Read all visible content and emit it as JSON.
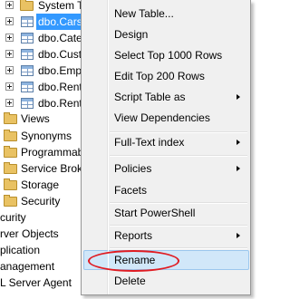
{
  "tree": {
    "rows": [
      {
        "label": "System Ta",
        "icon": "folder-icon"
      },
      {
        "label": "dbo.Cars",
        "icon": "table-icon",
        "selected": true
      },
      {
        "label": "dbo.Cate",
        "icon": "table-icon"
      },
      {
        "label": "dbo.Cust",
        "icon": "table-icon"
      },
      {
        "label": "dbo.Emp",
        "icon": "table-icon"
      },
      {
        "label": "dbo.Rent",
        "icon": "table-icon"
      },
      {
        "label": "dbo.Rent",
        "icon": "table-icon"
      },
      {
        "label": "Views",
        "icon": "folder-icon"
      },
      {
        "label": "Synonyms",
        "icon": "folder-icon"
      },
      {
        "label": "Programmab",
        "icon": "folder-icon"
      },
      {
        "label": "Service Brok",
        "icon": "folder-icon"
      },
      {
        "label": "Storage",
        "icon": "folder-icon"
      },
      {
        "label": "Security",
        "icon": "folder-icon"
      },
      {
        "label": "curity"
      },
      {
        "label": "rver Objects"
      },
      {
        "label": "plication"
      },
      {
        "label": "anagement"
      },
      {
        "label": "L Server Agent"
      }
    ]
  },
  "context_menu": {
    "items": [
      {
        "label": "New Table..."
      },
      {
        "label": "Design"
      },
      {
        "label": "Select Top 1000 Rows"
      },
      {
        "label": "Edit Top 200 Rows"
      },
      {
        "label": "Script Table as",
        "submenu": true
      },
      {
        "label": "View Dependencies"
      },
      {
        "label": "Full-Text index",
        "submenu": true
      },
      {
        "label": "Policies",
        "submenu": true
      },
      {
        "label": "Facets"
      },
      {
        "label": "Start PowerShell"
      },
      {
        "label": "Reports",
        "submenu": true
      },
      {
        "label": "Rename",
        "highlighted": true,
        "annotated": true
      },
      {
        "label": "Delete"
      }
    ]
  },
  "colors": {
    "selection": "#3399ff",
    "menu_background": "#f0f0f0",
    "menu_hover": "#d1e7f9",
    "annotation": "#e01b22"
  }
}
